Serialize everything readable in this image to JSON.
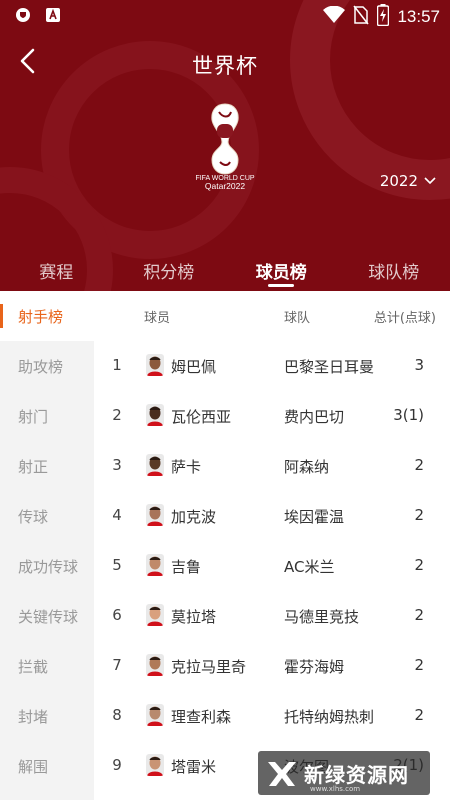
{
  "status_bar": {
    "time": "13:57",
    "left_icons": [
      "shield-icon",
      "a-badge-icon"
    ],
    "right_icons": [
      "wifi-icon",
      "no-sim-icon",
      "battery-charging-icon"
    ]
  },
  "header": {
    "title": "世界杯",
    "back_icon": "chevron-left-icon",
    "logo_caption_1": "FIFA WORLD CUP",
    "logo_caption_2": "Qatar2022",
    "year": "2022",
    "year_icon": "chevron-down-icon"
  },
  "tabs": [
    {
      "label": "赛程"
    },
    {
      "label": "积分榜"
    },
    {
      "label": "球员榜",
      "active": true
    },
    {
      "label": "球队榜"
    }
  ],
  "sidebar": [
    {
      "label": "射手榜",
      "active": true
    },
    {
      "label": "助攻榜"
    },
    {
      "label": "射门"
    },
    {
      "label": "射正"
    },
    {
      "label": "传球"
    },
    {
      "label": "成功传球"
    },
    {
      "label": "关键传球"
    },
    {
      "label": "拦截"
    },
    {
      "label": "封堵"
    },
    {
      "label": "解围"
    }
  ],
  "table": {
    "columns": {
      "player": "球员",
      "team": "球队",
      "total": "总计(点球)"
    },
    "rows": [
      {
        "rank": "1",
        "player": "姆巴佩",
        "team": "巴黎圣日耳曼",
        "total": "3"
      },
      {
        "rank": "2",
        "player": "瓦伦西亚",
        "team": "费内巴切",
        "total": "3(1)"
      },
      {
        "rank": "3",
        "player": "萨卡",
        "team": "阿森纳",
        "total": "2"
      },
      {
        "rank": "4",
        "player": "加克波",
        "team": "埃因霍温",
        "total": "2"
      },
      {
        "rank": "5",
        "player": "吉鲁",
        "team": "AC米兰",
        "total": "2"
      },
      {
        "rank": "6",
        "player": "莫拉塔",
        "team": "马德里竞技",
        "total": "2"
      },
      {
        "rank": "7",
        "player": "克拉马里奇",
        "team": "霍芬海姆",
        "total": "2"
      },
      {
        "rank": "8",
        "player": "理查利森",
        "team": "托特纳姆热刺",
        "total": "2"
      },
      {
        "rank": "9",
        "player": "塔雷米",
        "team": "波尔图",
        "total": "2(1)"
      }
    ]
  },
  "watermark": {
    "text": "新绿资源网",
    "url": "www.xlhs.com"
  },
  "colors": {
    "header": "#7d0a12",
    "accent": "#e8641a",
    "sidebar": "#f3f3f3"
  }
}
